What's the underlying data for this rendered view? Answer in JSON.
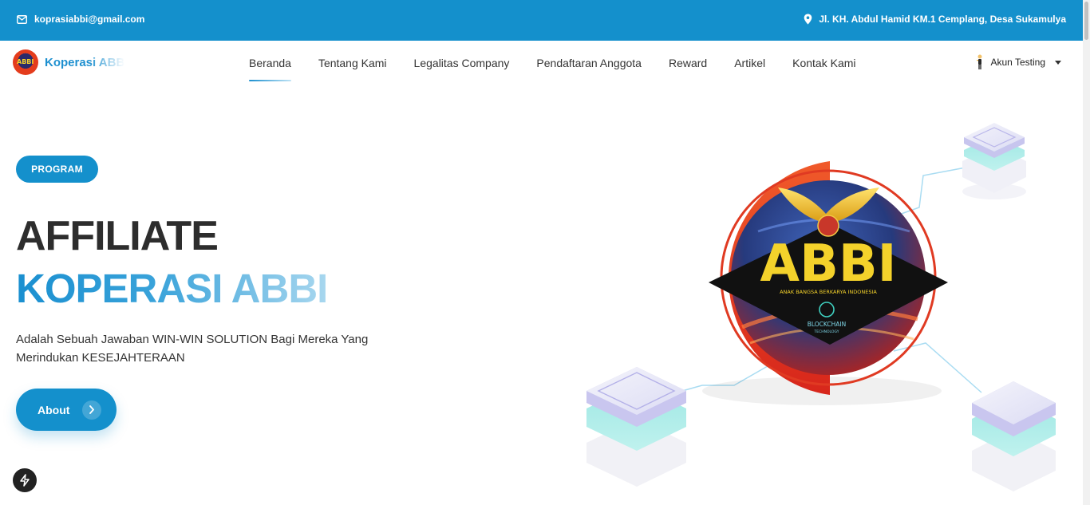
{
  "topbar": {
    "email": "koprasiabbi@gmail.com",
    "address": "Jl. KH. Abdul Hamid KM.1 Cemplang, Desa Sukamulya"
  },
  "navbar": {
    "brand": "Koperasi ABBI",
    "brand_logo_text": "ABBI",
    "menu": [
      {
        "label": "Beranda",
        "active": true
      },
      {
        "label": "Tentang Kami",
        "active": false
      },
      {
        "label": "Legalitas Company",
        "active": false
      },
      {
        "label": "Pendaftaran Anggota",
        "active": false
      },
      {
        "label": "Reward",
        "active": false
      },
      {
        "label": "Artikel",
        "active": false
      },
      {
        "label": "Kontak Kami",
        "active": false
      }
    ],
    "account_label": "Akun Testing"
  },
  "hero": {
    "badge": "PROGRAM",
    "title_line1": "AFFILIATE",
    "title_line2": "KOPERASI ABBI",
    "description": "Adalah Sebuah Jawaban WIN-WIN SOLUTION Bagi Mereka Yang Merindukan KESEJAHTERAAN",
    "button_label": "About",
    "logo_text": "ABBI",
    "logo_subtitle": "ANAK BANGSA BERKARYA INDONESIA",
    "logo_tech_line1": "BLOCKCHAIN",
    "logo_tech_line2": "TECHNOLOGY"
  },
  "colors": {
    "primary": "#1490cc",
    "title_dark": "#2d2d2d",
    "logo_red": "#e63a1f",
    "logo_gold": "#f4d22b"
  },
  "icons": {
    "email": "mail-icon",
    "address": "map-pin-icon",
    "account": "user-avatar-icon",
    "about_arrow": "chevron-right-icon",
    "floating": "lightning-icon"
  }
}
